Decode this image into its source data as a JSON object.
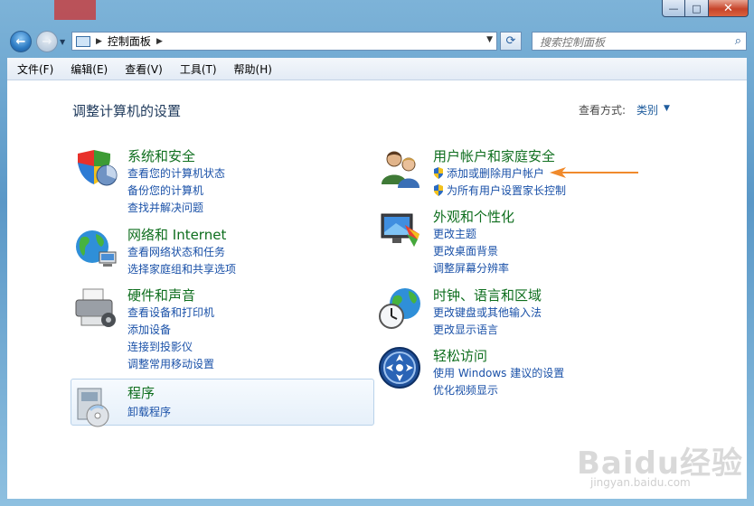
{
  "window": {
    "close_glyph": "✕",
    "max_glyph": "□",
    "min_glyph": "—"
  },
  "nav": {
    "back_glyph": "←",
    "forward_glyph": "→",
    "address_crumb": "控制面板",
    "search_placeholder": "搜索控制面板"
  },
  "menu": [
    "文件(F)",
    "编辑(E)",
    "查看(V)",
    "工具(T)",
    "帮助(H)"
  ],
  "main": {
    "title": "调整计算机的设置",
    "view_by_label": "查看方式:",
    "view_by_value": "类别"
  },
  "categories": {
    "system": {
      "title": "系统和安全",
      "links": [
        "查看您的计算机状态",
        "备份您的计算机",
        "查找并解决问题"
      ]
    },
    "network": {
      "title": "网络和 Internet",
      "links": [
        "查看网络状态和任务",
        "选择家庭组和共享选项"
      ]
    },
    "hardware": {
      "title": "硬件和声音",
      "links": [
        "查看设备和打印机",
        "添加设备",
        "连接到投影仪",
        "调整常用移动设置"
      ]
    },
    "programs": {
      "title": "程序",
      "links": [
        "卸载程序"
      ]
    },
    "users": {
      "title": "用户帐户和家庭安全",
      "links": [
        "添加或删除用户帐户",
        "为所有用户设置家长控制"
      ]
    },
    "appearance": {
      "title": "外观和个性化",
      "links": [
        "更改主题",
        "更改桌面背景",
        "调整屏幕分辨率"
      ]
    },
    "clock": {
      "title": "时钟、语言和区域",
      "links": [
        "更改键盘或其他输入法",
        "更改显示语言"
      ]
    },
    "ease": {
      "title": "轻松访问",
      "links": [
        "使用 Windows 建议的设置",
        "优化视频显示"
      ]
    }
  },
  "watermark": {
    "text": "Baidu经验",
    "sub": "jingyan.baidu.com"
  },
  "colors": {
    "link": "#1a51a8",
    "category_title": "#0e6e1e",
    "annotation_arrow": "#f08a2c"
  }
}
